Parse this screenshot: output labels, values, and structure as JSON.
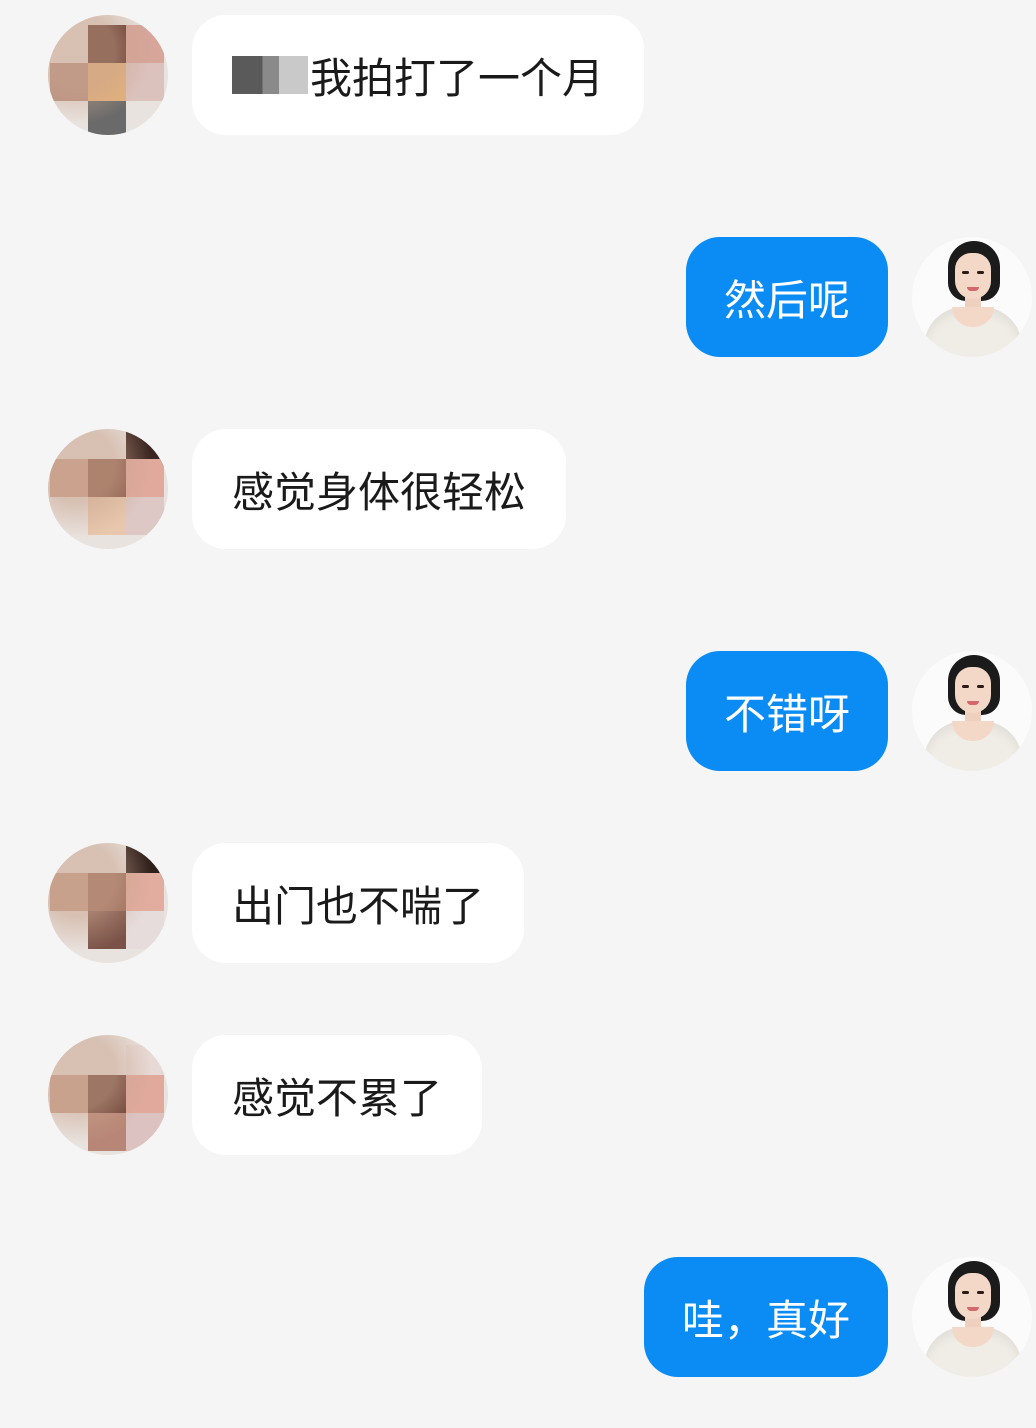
{
  "chat": {
    "messages": [
      {
        "sender": "other",
        "text": "我拍打了一个月",
        "redacted_prefix": true
      },
      {
        "sender": "self",
        "text": "然后呢"
      },
      {
        "sender": "other",
        "text": "感觉身体很轻松"
      },
      {
        "sender": "self",
        "text": "不错呀"
      },
      {
        "sender": "other",
        "text": "出门也不喘了"
      },
      {
        "sender": "other",
        "text": "感觉不累了"
      },
      {
        "sender": "self",
        "text": "哇，真好"
      }
    ]
  },
  "colors": {
    "background": "#f5f5f5",
    "incoming_bubble": "#ffffff",
    "outgoing_bubble": "#0b8cf5",
    "outgoing_text": "#ffffff",
    "incoming_text": "#1a1a1a"
  }
}
